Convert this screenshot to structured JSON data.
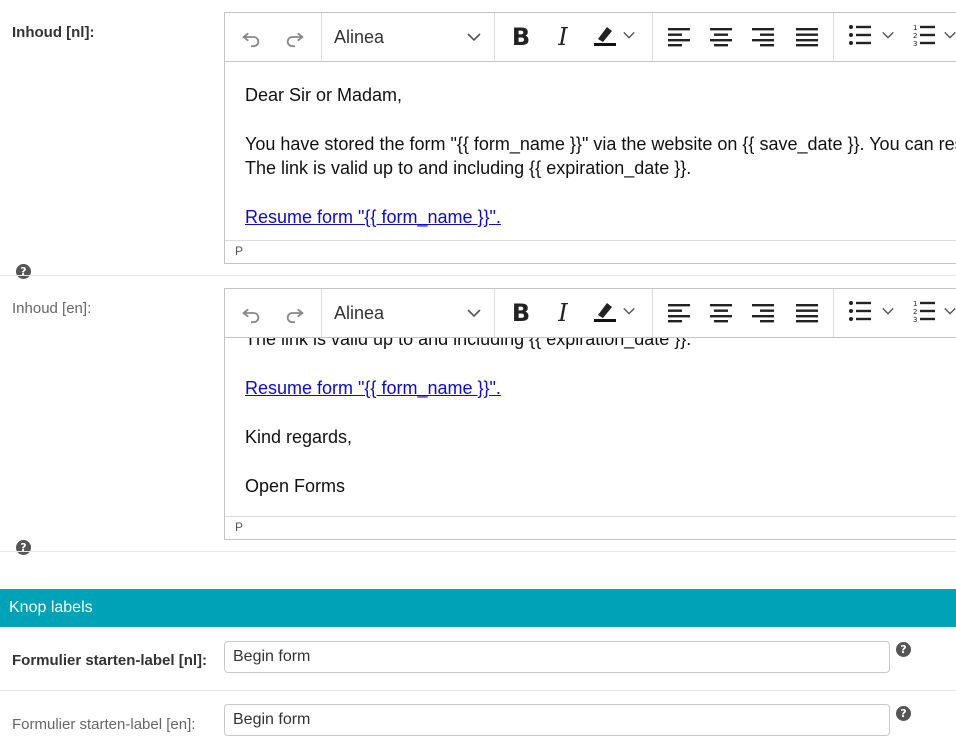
{
  "editor_toolbar": {
    "undo_icon": "undo-icon",
    "redo_icon": "redo-icon",
    "heading_value": "Alinea",
    "bold_icon": "bold-icon",
    "italic_icon": "italic-icon",
    "highlight_icon": "highlight-icon",
    "align_left_icon": "align-left-icon",
    "align_center_icon": "align-center-icon",
    "align_right_icon": "align-right-icon",
    "align_justify_icon": "align-justify-icon",
    "bulleted_list_icon": "bulleted-list-icon",
    "numbered_list_icon": "numbered-list-icon"
  },
  "content_nl": {
    "label": "Inhoud [nl]:",
    "greeting": "Dear Sir or Madam,",
    "line1": "You have stored the form \"{{ form_name }}\" via the website on {{ save_date }}. You can resume",
    "line2": "The link is valid up to and including {{ expiration_date }}.",
    "link": "Resume form \"{{ form_name }}\".",
    "status": "P"
  },
  "content_en": {
    "label": "Inhoud [en]:",
    "line2": "The link is valid up to and including {{ expiration_date }}.",
    "link": "Resume form \"{{ form_name }}\".",
    "regards": "Kind regards,",
    "signature": "Open Forms",
    "status": "P"
  },
  "section": {
    "title": "Knop labels"
  },
  "start_label_nl": {
    "label": "Formulier starten-label [nl]:",
    "value": "Begin form"
  },
  "start_label_en": {
    "label": "Formulier starten-label [en]:",
    "value": "Begin form"
  },
  "help_glyph": "?"
}
